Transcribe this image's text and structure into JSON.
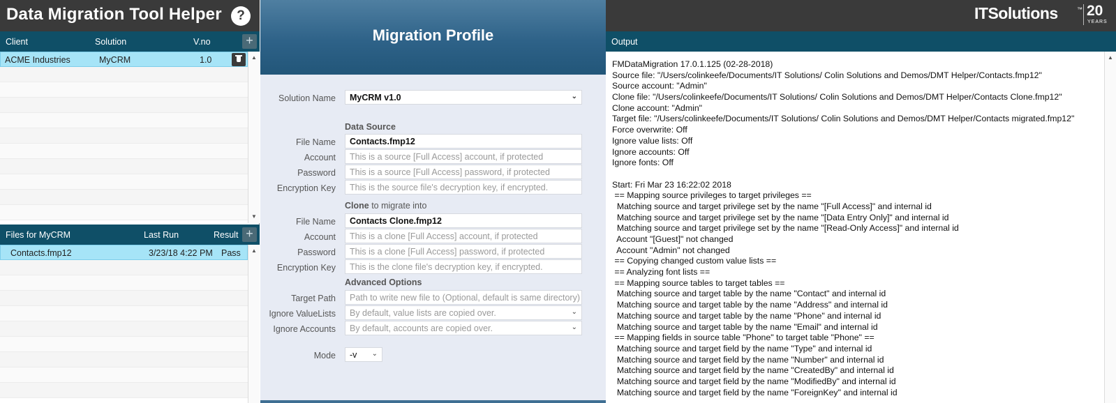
{
  "app": {
    "title": "Data Migration Tool Helper",
    "help_label": "?"
  },
  "clients": {
    "headers": {
      "client": "Client",
      "solution": "Solution",
      "version": "V.no"
    },
    "add_label": "+",
    "rows": [
      {
        "client": "ACME Industries",
        "solution": "MyCRM",
        "version": "1.0"
      }
    ]
  },
  "files": {
    "headers": {
      "title": "Files for MyCRM",
      "last_run": "Last Run",
      "result": "Result"
    },
    "add_label": "+",
    "rows": [
      {
        "file": "Contacts.fmp12",
        "last_run": "3/23/18 4:22 PM",
        "result": "Pass"
      }
    ]
  },
  "profile": {
    "title": "Migration Profile",
    "solution_name": {
      "label": "Solution Name",
      "value": "MyCRM v1.0"
    },
    "data_source": {
      "section": "Data Source",
      "file_name": {
        "label": "File Name",
        "value": "Contacts.fmp12"
      },
      "account": {
        "label": "Account",
        "placeholder": "This is a source [Full Access] account, if protected"
      },
      "password": {
        "label": "Password",
        "placeholder": "This is a source [Full Access] password, if protected"
      },
      "encryption_key": {
        "label": "Encryption Key",
        "placeholder": "This is the source file's decryption key, if encrypted."
      }
    },
    "clone": {
      "section_bold": "Clone",
      "section_rest": " to migrate into",
      "file_name": {
        "label": "File Name",
        "value": "Contacts Clone.fmp12"
      },
      "account": {
        "label": "Account",
        "placeholder": "This is a clone [Full Access] account, if protected"
      },
      "password": {
        "label": "Password",
        "placeholder": "This is a clone [Full Access] password, if protected"
      },
      "encryption_key": {
        "label": "Encryption Key",
        "placeholder": "This is the clone file's decryption key, if encrypted."
      }
    },
    "advanced": {
      "section": "Advanced Options",
      "target_path": {
        "label": "Target Path",
        "placeholder": "Path to write new file to (Optional, default is same directory)"
      },
      "ignore_value_lists": {
        "label": "Ignore ValueLists",
        "placeholder": "By default, value lists are copied over."
      },
      "ignore_accounts": {
        "label": "Ignore Accounts",
        "placeholder": "By default, accounts are copied over."
      }
    },
    "mode": {
      "label": "Mode",
      "value": "-v"
    }
  },
  "brand": {
    "name": "ITSolutions",
    "years": "20",
    "years_label": "YEARS"
  },
  "output": {
    "header": "Output",
    "lines": [
      "FMDataMigration 17.0.1.125 (02-28-2018)",
      "Source file: \"/Users/colinkeefe/Documents/IT Solutions/ Colin Solutions and Demos/DMT Helper/Contacts.fmp12\"",
      "Source account: \"Admin\"",
      "Clone file: \"/Users/colinkeefe/Documents/IT Solutions/ Colin Solutions and Demos/DMT Helper/Contacts Clone.fmp12\"",
      "Clone account: \"Admin\"",
      "Target file: \"/Users/colinkeefe/Documents/IT Solutions/ Colin Solutions and Demos/DMT Helper/Contacts migrated.fmp12\"",
      "Force overwrite: Off",
      "Ignore value lists: Off",
      "Ignore accounts: Off",
      "Ignore fonts: Off",
      "",
      "Start: Fri Mar 23 16:22:02 2018",
      " == Mapping source privileges to target privileges ==",
      "  Matching source and target privilege set by the name \"[Full Access]\" and internal id",
      "  Matching source and target privilege set by the name \"[Data Entry Only]\" and internal id",
      "  Matching source and target privilege set by the name \"[Read-Only Access]\" and internal id",
      "  Account \"[Guest]\" not changed",
      "  Account \"Admin\" not changed",
      " == Copying changed custom value lists ==",
      " == Analyzing font lists ==",
      " == Mapping source tables to target tables ==",
      "  Matching source and target table by the name \"Contact\" and internal id",
      "  Matching source and target table by the name \"Address\" and internal id",
      "  Matching source and target table by the name \"Phone\" and internal id",
      "  Matching source and target table by the name \"Email\" and internal id",
      " == Mapping fields in source table \"Phone\" to target table \"Phone\" ==",
      "  Matching source and target field by the name \"Type\" and internal id",
      "  Matching source and target field by the name \"Number\" and internal id",
      "  Matching source and target field by the name \"CreatedBy\" and internal id",
      "  Matching source and target field by the name \"ModifiedBy\" and internal id",
      "  Matching source and target field by the name \"ForeignKey\" and internal id"
    ]
  }
}
